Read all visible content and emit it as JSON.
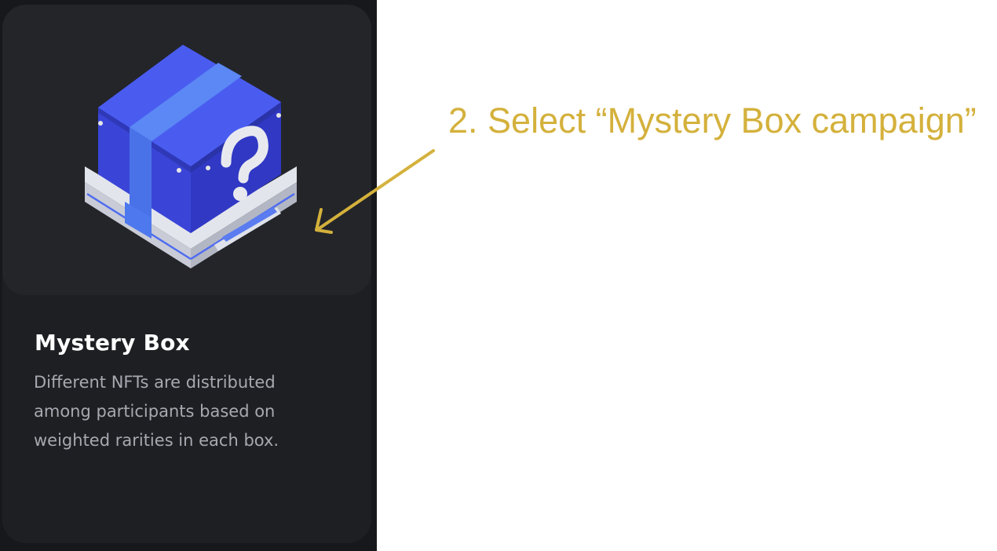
{
  "card": {
    "title": "Mystery Box",
    "description": "Different NFTs are distributed among participants based on weighted rarities in each box.",
    "image_icon": "mystery-box-illustration"
  },
  "annotation": {
    "text": "2. Select “Mystery Box campaign”",
    "color": "#d4b13c"
  },
  "colors": {
    "panel_bg": "#17181b",
    "card_bg": "#1e1f23",
    "media_bg": "#232529",
    "box_blue": "#3f52e0",
    "box_band": "#5a86f2",
    "base_silver": "#d9dbe3"
  }
}
